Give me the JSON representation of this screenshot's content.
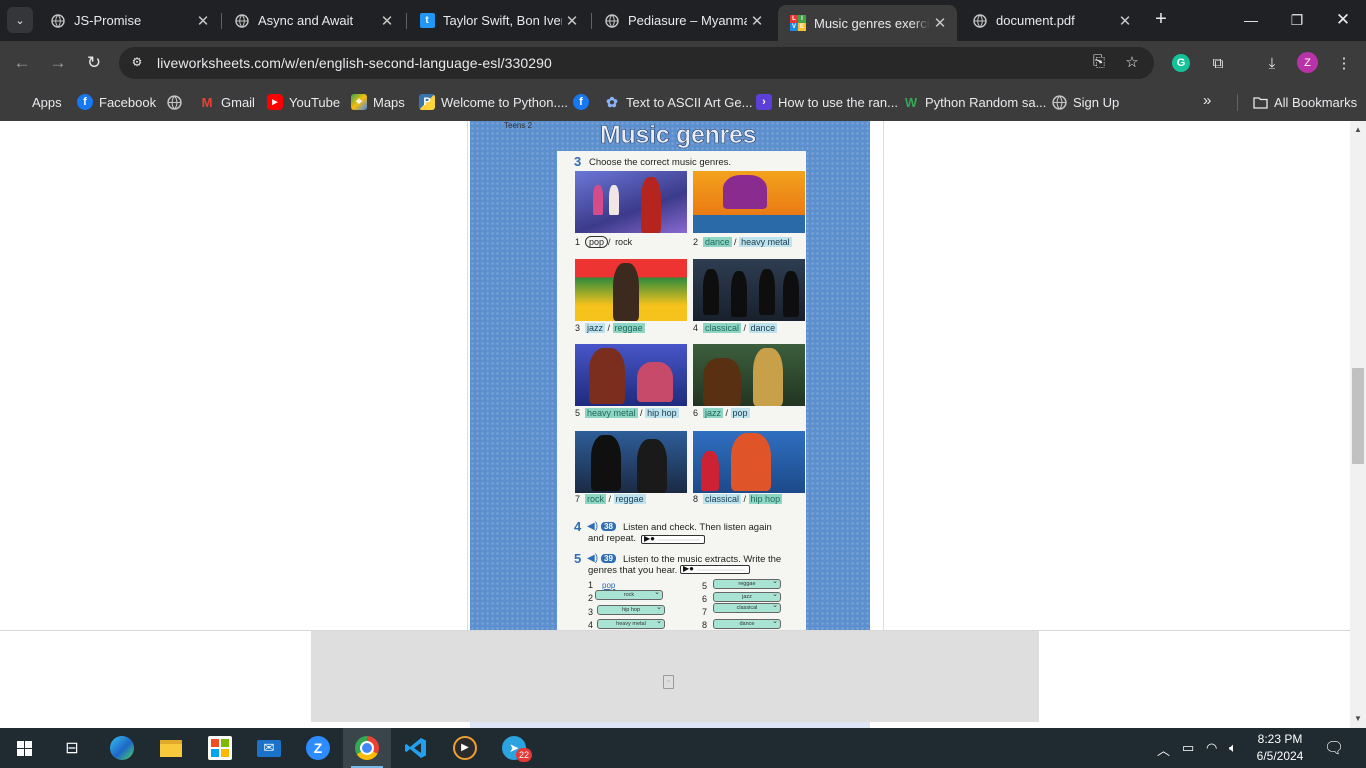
{
  "browser": {
    "tabs": [
      {
        "title": "JS-Promise",
        "icon": "globe-icon",
        "active": false
      },
      {
        "title": "Async and Await",
        "icon": "globe-icon",
        "active": false
      },
      {
        "title": "Taylor Swift, Bon Iver",
        "icon": "t-logo-icon",
        "active": false
      },
      {
        "title": "Pediasure – Myanmar",
        "icon": "globe-icon",
        "active": false
      },
      {
        "title": "Music genres exercise",
        "icon": "liveworksheets-icon",
        "active": true
      },
      {
        "title": "document.pdf",
        "icon": "globe-icon",
        "active": false
      }
    ],
    "url": "liveworksheets.com/w/en/english-second-language-esl/330290",
    "profile_initial": "Z",
    "bookmarks": [
      {
        "label": "Apps",
        "icon": "apps-grid-icon"
      },
      {
        "label": "Facebook",
        "icon": "facebook-icon"
      },
      {
        "label": "",
        "icon": "globe-icon"
      },
      {
        "label": "Gmail",
        "icon": "gmail-icon"
      },
      {
        "label": "YouTube",
        "icon": "youtube-icon"
      },
      {
        "label": "Maps",
        "icon": "maps-icon"
      },
      {
        "label": "Welcome to Python....",
        "icon": "python-icon"
      },
      {
        "label": "",
        "icon": "facebook-icon"
      },
      {
        "label": "Text to ASCII Art Ge...",
        "icon": "ascii-art-icon"
      },
      {
        "label": "How to use the ran...",
        "icon": "terminal-icon"
      },
      {
        "label": "Python Random sa...",
        "icon": "w-logo-icon"
      },
      {
        "label": "Sign Up",
        "icon": "globe-icon"
      }
    ],
    "all_bookmarks_label": "All Bookmarks"
  },
  "worksheet": {
    "book_label": "Teens 2",
    "title": "Music genres",
    "ex3": {
      "number": "3",
      "instruction": "Choose the correct music genres.",
      "items": [
        {
          "n": "1",
          "opt1": "pop",
          "opt2": "rock",
          "answer": "pop"
        },
        {
          "n": "2",
          "opt1": "dance",
          "opt2": "heavy metal",
          "answer": "dance"
        },
        {
          "n": "3",
          "opt1": "jazz",
          "opt2": "reggae",
          "answer": "reggae"
        },
        {
          "n": "4",
          "opt1": "classical",
          "opt2": "dance",
          "answer": "classical"
        },
        {
          "n": "5",
          "opt1": "heavy metal",
          "opt2": "hip hop",
          "answer": "heavy metal"
        },
        {
          "n": "6",
          "opt1": "jazz",
          "opt2": "pop",
          "answer": "jazz"
        },
        {
          "n": "7",
          "opt1": "rock",
          "opt2": "reggae",
          "answer": "rock"
        },
        {
          "n": "8",
          "opt1": "classical",
          "opt2": "hip hop",
          "answer": "hip hop"
        }
      ]
    },
    "ex4": {
      "number": "4",
      "track": "38",
      "line1": "Listen and check. Then listen again",
      "line2": "and repeat."
    },
    "ex5": {
      "number": "5",
      "track": "39",
      "line1": "Listen to the music extracts. Write the",
      "line2": "genres that you hear.",
      "answers": [
        {
          "n": "1",
          "value": "pop",
          "type": "text"
        },
        {
          "n": "2",
          "value": "rock",
          "type": "select"
        },
        {
          "n": "3",
          "value": "hip hop",
          "type": "select"
        },
        {
          "n": "4",
          "value": "heavy metal",
          "type": "select"
        },
        {
          "n": "5",
          "value": "reggae",
          "type": "select"
        },
        {
          "n": "6",
          "value": "jazz",
          "type": "select"
        },
        {
          "n": "7",
          "value": "classical",
          "type": "select"
        },
        {
          "n": "8",
          "value": "dance",
          "type": "select"
        }
      ]
    }
  },
  "taskbar": {
    "apps": [
      "start-icon",
      "task-view-icon",
      "edge-icon",
      "file-explorer-icon",
      "store-icon",
      "mail-icon",
      "zoom-icon",
      "chrome-icon",
      "vscode-icon",
      "media-player-icon",
      "telegram-icon"
    ],
    "telegram_badge": "22",
    "time": "8:23 PM",
    "date": "6/5/2024"
  },
  "colors": {
    "chrome_dark": "#202124",
    "chrome_toolbar": "#3c3c3c",
    "worksheet_blue": "#5b8fcd",
    "answer_highlight": "#8fd5c4",
    "taskbar": "#1f2a31"
  }
}
